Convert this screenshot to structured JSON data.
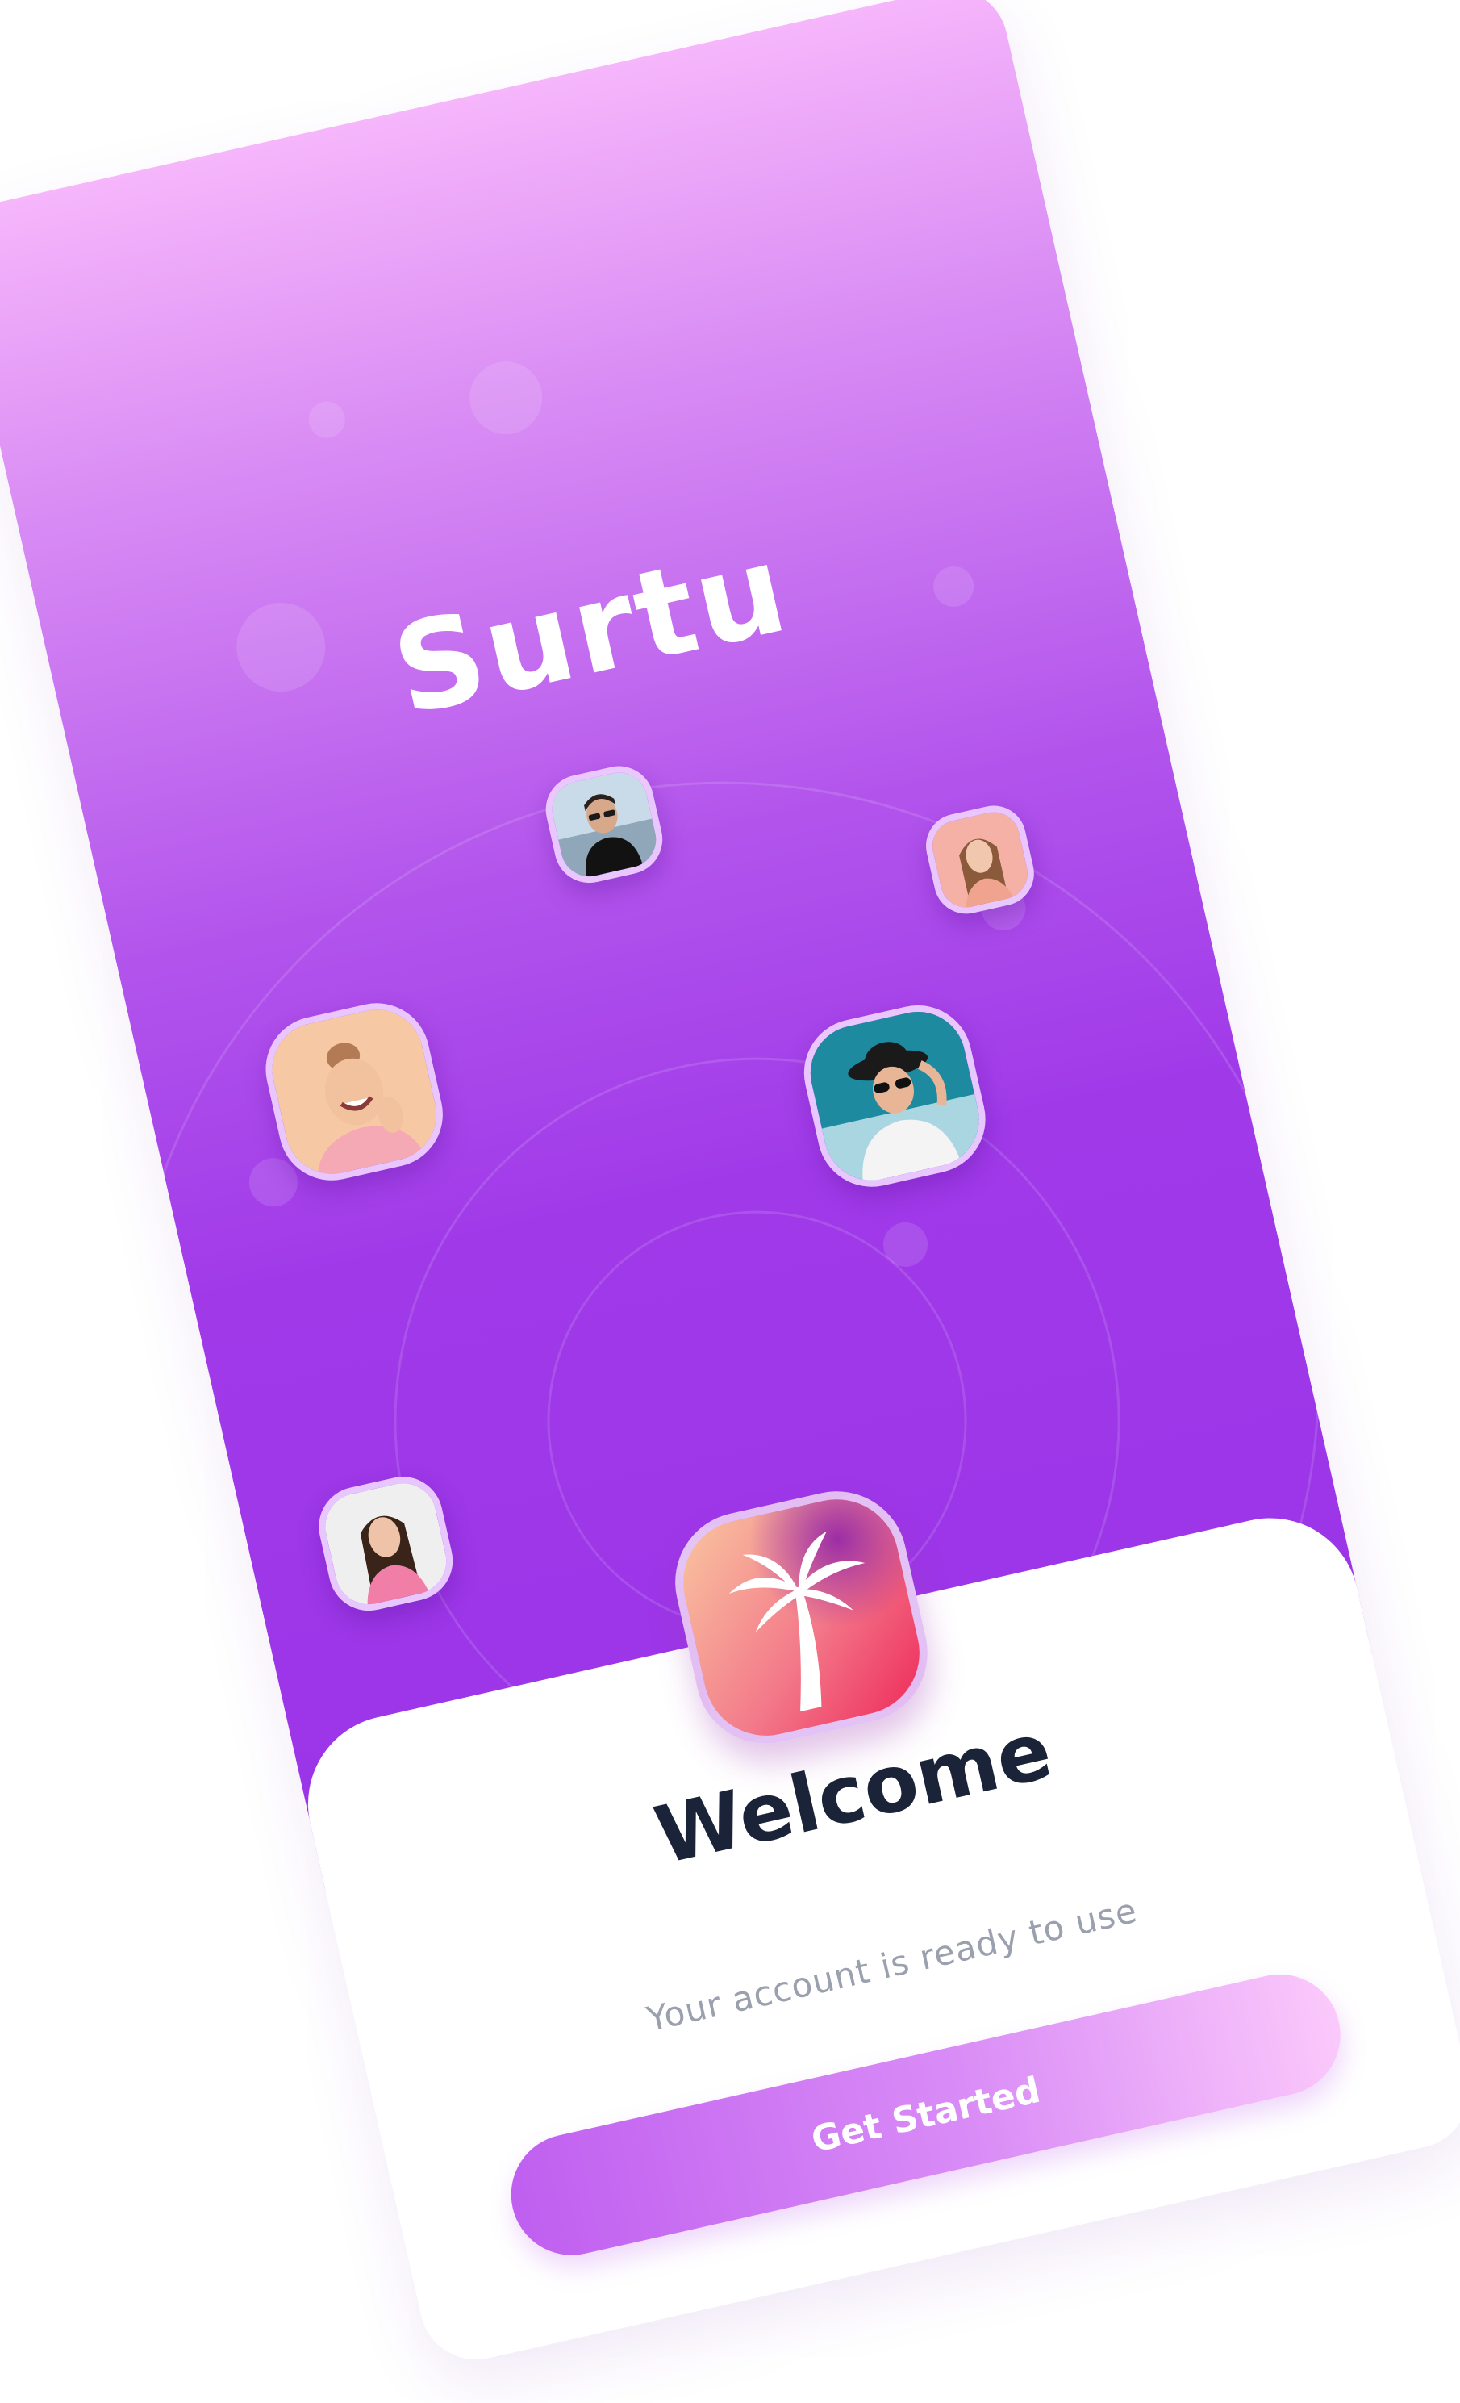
{
  "app": {
    "brand_name": "Surtu"
  },
  "welcome": {
    "title": "Welcome",
    "subtitle": "Your account is ready to use"
  },
  "actions": {
    "get_started_label": "Get Started"
  },
  "icons": {
    "app_logo": "palm-tree-icon"
  },
  "avatars": [
    {
      "name": "avatar-man-sunglasses"
    },
    {
      "name": "avatar-woman-pink-bg"
    },
    {
      "name": "avatar-woman-laughing"
    },
    {
      "name": "avatar-woman-hat-sunglasses"
    },
    {
      "name": "avatar-woman-long-hair"
    }
  ],
  "colors": {
    "gradient_top": "#f6b6fb",
    "gradient_bottom": "#9a34e7",
    "title_color": "#1a2338",
    "subtitle_color": "#9aa0ae",
    "button_start": "#c05ff0",
    "button_end": "#fbc9fb",
    "icon_start": "#f9c5a0",
    "icon_end": "#ee2a5a"
  }
}
